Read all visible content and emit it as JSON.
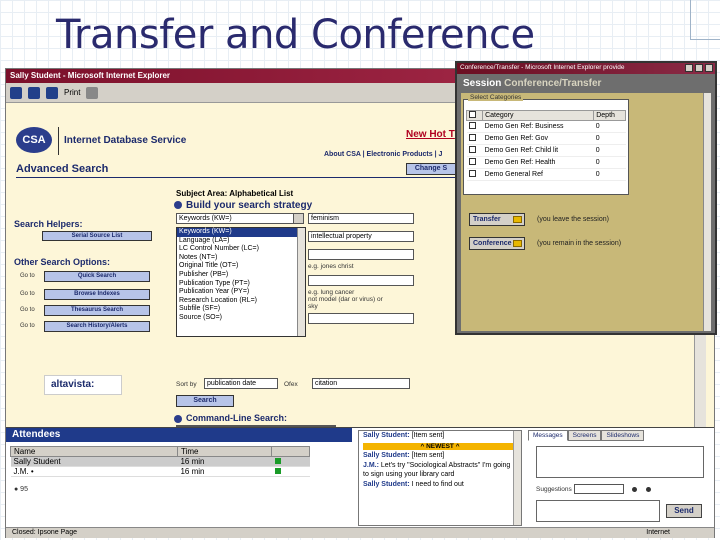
{
  "slide": {
    "title": "Transfer and Conference"
  },
  "browser": {
    "window_title": "Sally Student - Microsoft Internet Explorer",
    "toolbar_label": "Print",
    "page": {
      "logo_text": "CSA",
      "service_title": "Internet Database Service",
      "new_hot": "New Hot T",
      "top_links": "About CSA | Electronic Products | J",
      "change_button": "Change S",
      "advanced_title": "Advanced Search",
      "subject_area": "Subject Area: Alphabetical List",
      "build_title": "Build your search strategy",
      "helpers_label": "Search Helpers:",
      "serial_button": "Serial Source List",
      "other_label": "Other Search Options:",
      "goto": "Go to",
      "other_buttons": [
        "Quick Search",
        "Browse Indexes",
        "Thesaurus Search",
        "Search History/Alerts"
      ],
      "alta_text": "altavista:",
      "field_select_value": "Keywords (KW=)",
      "field_list": [
        "Keywords (KW=)",
        "Language (LA=)",
        "LC Control Number (LC=)",
        "Notes (NT=)",
        "Original Title (OT=)",
        "Publisher (PB=)",
        "Publication Type (PT=)",
        "Publication Year (PY=)",
        "Research Location (RL=)",
        "Subfile (SF=)",
        "Source (SO=)"
      ],
      "text_values": [
        "feminism",
        "intellectual property"
      ],
      "hint1": "e.g. jones christ",
      "hint2": "e.g. lung cancer\nnot model (dar or virus) or\nsky",
      "sort_label": "Sort by",
      "sort_value": "publication date",
      "order_label": "Ofex",
      "order_value": "citation",
      "search_button": "Search",
      "cmd_title": "Command-Line Search:"
    },
    "attendees": {
      "header": "Attendees",
      "columns": [
        "Name",
        "Time"
      ],
      "rows": [
        {
          "name": "Sally Student",
          "time": "16 min"
        },
        {
          "name": "J.M. •",
          "time": "16 min"
        }
      ],
      "footnote": "● 95"
    },
    "chat": {
      "lines": [
        {
          "sender": "Sally Student:",
          "text": "[Item sent]"
        },
        {
          "sender": "",
          "text": "^ NEWEST ^"
        },
        {
          "sender": "Sally Student:",
          "text": "[Item sent]"
        },
        {
          "sender": "J.M.:",
          "text": "Let's try \"Sociological Abstracts\" I'm going to sign using your library card"
        },
        {
          "sender": "Sally Student:",
          "text": "I need to find out"
        }
      ]
    },
    "tabs": [
      "Messages",
      "Screens",
      "Slideshows"
    ],
    "suggestions_label": "Suggestions",
    "send_button": "Send",
    "status_left": "Closed: Ipsone Page",
    "status_right": "Internet"
  },
  "session": {
    "window_title": "Conference/Transfer - Microsoft Internet Explorer provide",
    "header_prefix": "Session",
    "header_title": "Conference/Transfer",
    "box_caption": "Select Categories",
    "columns": [
      "Category",
      "Depth"
    ],
    "rows": [
      {
        "category": "Demo Gen Ref: Business",
        "depth": "0"
      },
      {
        "category": "Demo Gen Ref: Gov",
        "depth": "0"
      },
      {
        "category": "Demo Gen Ref: Child lit",
        "depth": "0"
      },
      {
        "category": "Demo Gen Ref: Health",
        "depth": "0"
      },
      {
        "category": "Demo General Ref",
        "depth": "0"
      }
    ],
    "transfer_button": "Transfer",
    "transfer_desc": "(you leave the session)",
    "conference_button": "Conference",
    "conference_desc": "(you remain in the session)"
  }
}
